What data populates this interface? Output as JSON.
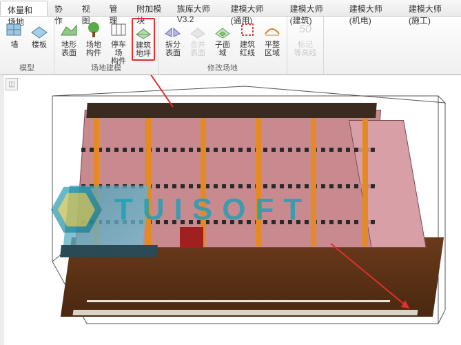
{
  "tabs": {
    "items": [
      {
        "label": "体量和场地",
        "active": true
      },
      {
        "label": "协作"
      },
      {
        "label": "视图"
      },
      {
        "label": "管理"
      },
      {
        "label": "附加模块"
      },
      {
        "label": "族库大师V3.2"
      },
      {
        "label": "建模大师 (通用)"
      },
      {
        "label": "建模大师 (建筑)"
      },
      {
        "label": "建模大师 (机电)"
      },
      {
        "label": "建模大师 (施工)"
      }
    ]
  },
  "ribbon": {
    "groups": [
      {
        "name": "model",
        "label": "模型",
        "items": [
          {
            "name": "wall",
            "label": "墙",
            "icon": "wall-icon"
          },
          {
            "name": "floor-slab",
            "label": "楼板",
            "icon": "floor-icon"
          }
        ]
      },
      {
        "name": "site-modeling",
        "label": "场地建模",
        "items": [
          {
            "name": "toposurface",
            "label": "地形表面",
            "icon": "topo-icon"
          },
          {
            "name": "site-component",
            "label": "场地\n构件",
            "icon": "tree-icon"
          },
          {
            "name": "parking-component",
            "label": "停车场\n构件",
            "icon": "parking-icon"
          },
          {
            "name": "building-pad",
            "label": "建筑\n地坪",
            "icon": "pad-icon",
            "highlighted": true
          }
        ]
      },
      {
        "name": "modify-site",
        "label": "修改场地",
        "items": [
          {
            "name": "split-surface",
            "label": "拆分\n表面",
            "icon": "split-icon"
          },
          {
            "name": "merge",
            "label": "合并\n表面",
            "icon": "merge-icon",
            "disabled": true
          },
          {
            "name": "subregion",
            "label": "子面域",
            "icon": "subregion-icon"
          },
          {
            "name": "property-line",
            "label": "建筑\n红线",
            "icon": "propline-icon"
          },
          {
            "name": "graded-region",
            "label": "平整\n区域",
            "icon": "grade-icon"
          }
        ]
      },
      {
        "name": "annotate",
        "label": "",
        "items": [
          {
            "name": "label-contour",
            "label": "标记\n等高线",
            "icon": "contour-icon",
            "disabled": true,
            "value": "50"
          }
        ]
      }
    ]
  },
  "viewport": {
    "nav_cube": "◫"
  },
  "watermark": {
    "text": "TUISOFT"
  },
  "annotations": {
    "highlight_target": "building-pad"
  }
}
